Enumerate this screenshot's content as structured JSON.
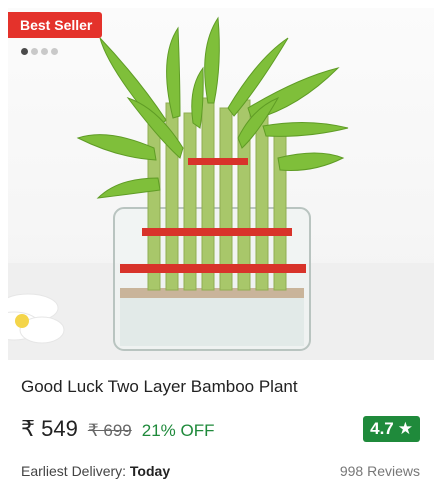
{
  "badge": {
    "label": "Best Seller",
    "color": "#e4322b"
  },
  "carousel": {
    "total": 4,
    "active": 1
  },
  "product": {
    "title": "Good Luck Two Layer Bamboo Plant",
    "price": "₹ 549",
    "mrp": "₹ 699",
    "discount": "21% OFF",
    "rating": "4.7",
    "rating_icon": "star-icon",
    "delivery_label": "Earliest Delivery:",
    "delivery_value": "Today",
    "reviews": "998  Reviews"
  },
  "colors": {
    "accent_green": "#1f8a3b"
  }
}
